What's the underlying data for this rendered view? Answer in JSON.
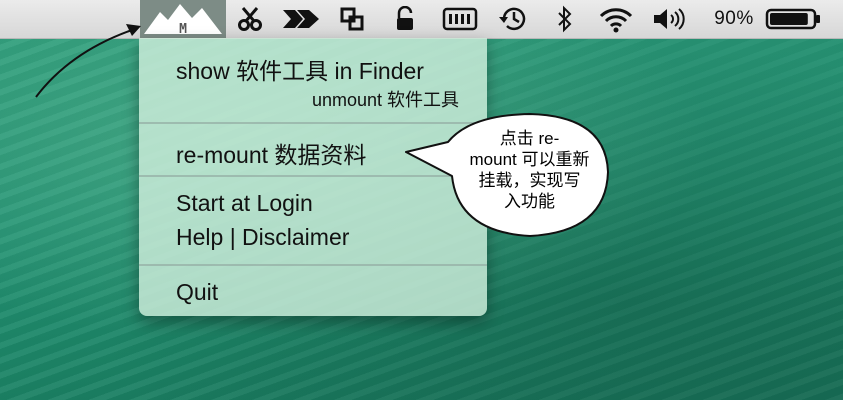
{
  "menubar": {
    "app_icon": "mountain-m-icon",
    "app_letter": "M",
    "icons": [
      "scissors-icon",
      "arrow-icon",
      "crop-icon",
      "lock-icon",
      "memory-icon",
      "time-machine-icon",
      "bluetooth-icon",
      "wifi-icon",
      "volume-icon",
      "battery-icon"
    ],
    "battery_percent": "90%",
    "battery_level": 0.9
  },
  "menu": {
    "items": [
      {
        "label": "show 软件工具 in Finder"
      },
      {
        "label": "unmount 软件工具"
      },
      {
        "label": "re-mount 数据资料"
      },
      {
        "label": "Start at Login"
      },
      {
        "label": "Help | Disclaimer"
      },
      {
        "label": "Quit"
      }
    ]
  },
  "callout": {
    "lines": [
      "点击 re-",
      "mount 可以重新",
      "挂载，实现写",
      "入功能"
    ]
  },
  "colors": {
    "menubar": "#e2e2e2",
    "menu_bg": "#ceeedc",
    "desktop": "#239374",
    "app_icon_bg": "#7d8c86"
  }
}
